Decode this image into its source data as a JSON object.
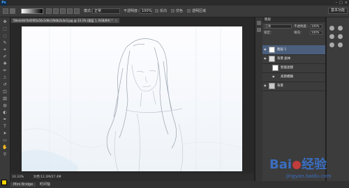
{
  "menubar": {
    "logo": "Ps"
  },
  "options": {
    "mode_label": "模式：",
    "mode_value": "正常",
    "opacity_label": "不透明度：",
    "opacity_value": "100%",
    "reverse_label": "反向",
    "dither_label": "仿色",
    "transparency_label": "透明区域",
    "workspace": "基本功能"
  },
  "document": {
    "tab_title": "58e4c8d7b92f85a50c3d6e1fb6b2a3e3.jpg @ 33.3% (图层 1, RGB/8#) *",
    "zoom": "33.33%",
    "doc_size": "文档:12.2M/27.4M"
  },
  "mini_bridge": {
    "tab_label": "Mini Bridge",
    "timeline_label": "时间轴"
  },
  "layers_panel": {
    "tab_label": "图层",
    "blend_mode": "正常",
    "opacity_label": "不透明度：",
    "opacity_value": "100%",
    "lock_label": "锁定：",
    "fill_label": "填充：",
    "fill_value": "100%",
    "layers": [
      {
        "name": "图层 1",
        "selected": true
      },
      {
        "name": "背景 副本",
        "selected": false
      },
      {
        "name": "智能滤镜",
        "selected": false
      },
      {
        "name": "高斯模糊",
        "selected": false
      },
      {
        "name": "背景",
        "selected": false
      }
    ]
  },
  "watermark": {
    "brand": "Bai",
    "brand_suffix": "经验",
    "url": "jingyan.baidu.com"
  },
  "colors": {
    "foreground": "#f2d300",
    "background": "#ffffff",
    "selected_layer": "#4b5f7d"
  }
}
